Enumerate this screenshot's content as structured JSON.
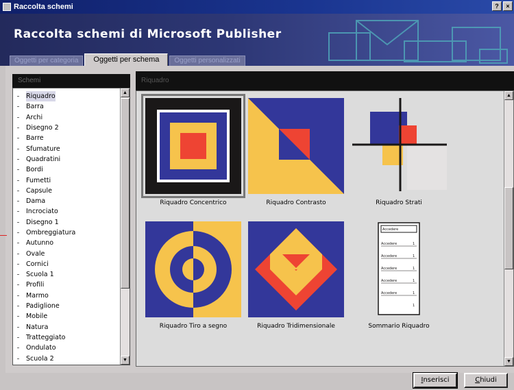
{
  "window": {
    "title": "Raccolta schemi",
    "controls": [
      "?",
      "×"
    ]
  },
  "banner": {
    "title": "Raccolta schemi di Microsoft Publisher"
  },
  "tabs": [
    {
      "label": "Oggetti per categoria",
      "active": false
    },
    {
      "label": "Oggetti per schema",
      "active": true
    },
    {
      "label": "Oggetti personalizzati",
      "active": false
    }
  ],
  "schemes": {
    "header": "Schemi",
    "selected": "Riquadro",
    "items": [
      "Riquadro",
      "Barra",
      "Archi",
      "Disegno 2",
      "Barre",
      "Sfumature",
      "Quadratini",
      "Bordi",
      "Fumetti",
      "Capsule",
      "Dama",
      "Incrociato",
      "Disegno 1",
      "Ombreggiatura",
      "Autunno",
      "Ovale",
      "Cornici",
      "Scuola 1",
      "Profili",
      "Marmo",
      "Padiglione",
      "Mobile",
      "Natura",
      "Tratteggiato",
      "Ondulato",
      "Scuola 2"
    ]
  },
  "objects": {
    "header": "Riquadro",
    "items": [
      {
        "label": "Riquadro Concentrico",
        "icon": "concentric-box-icon"
      },
      {
        "label": "Riquadro Contrasto",
        "icon": "contrast-box-icon"
      },
      {
        "label": "Riquadro Strati",
        "icon": "layers-box-icon"
      },
      {
        "label": "Riquadro Tiro a segno",
        "icon": "target-box-icon"
      },
      {
        "label": "Riquadro Tridimensionale",
        "icon": "3d-box-icon"
      },
      {
        "label": "Sommario Riquadro",
        "icon": "toc-box-icon"
      }
    ],
    "toc_rows": [
      "Accedere",
      "Accedere",
      "Accedere",
      "Accedere",
      "Accedere",
      "Accedere"
    ]
  },
  "buttons": {
    "insert_u": "I",
    "insert_rest": "nserisci",
    "close_u": "C",
    "close_rest": "hiudi"
  },
  "colors": {
    "blue": "#33379a",
    "yellow": "#f6c34c",
    "red": "#ee4433",
    "black": "#1a1818"
  }
}
